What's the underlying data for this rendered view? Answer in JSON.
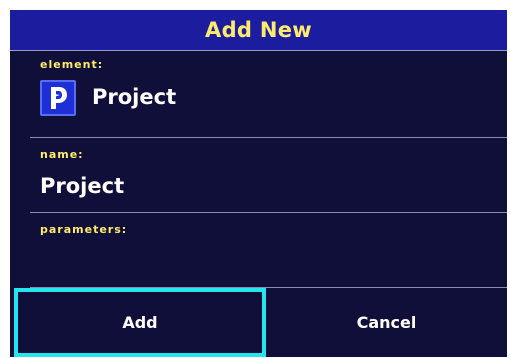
{
  "dialog": {
    "title": "Add New"
  },
  "fields": {
    "element": {
      "label": "element:",
      "value": "Project",
      "icon": "project-icon"
    },
    "name": {
      "label": "name:",
      "value": "Project"
    },
    "parameters": {
      "label": "parameters:"
    }
  },
  "buttons": {
    "add": "Add",
    "cancel": "Cancel"
  },
  "colors": {
    "background": "#0f0f3a",
    "title_bar": "#1c1c9e",
    "label": "#ffeb6b",
    "focus_border": "#25e6ee",
    "icon_bg": "#1f2fd6"
  }
}
